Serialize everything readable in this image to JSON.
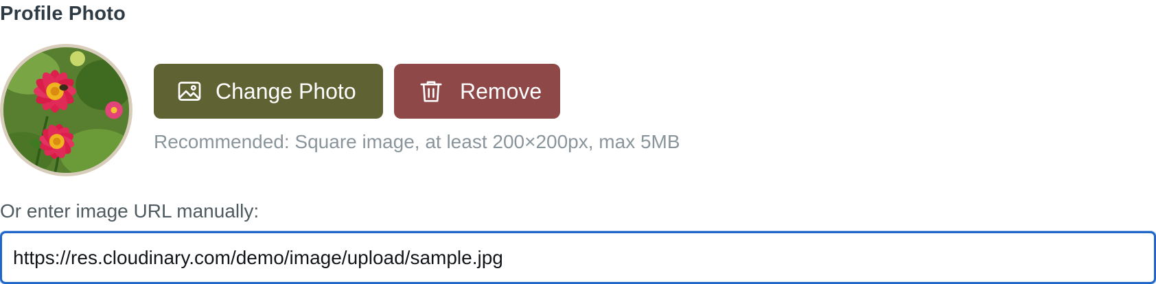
{
  "profile_photo": {
    "title": "Profile Photo",
    "avatar_icon": "flower-photo-avatar",
    "change_button": {
      "label": "Change Photo",
      "icon": "image-icon"
    },
    "remove_button": {
      "label": "Remove",
      "icon": "trash-icon"
    },
    "hint": "Recommended: Square image, at least 200×200px, max 5MB"
  },
  "url_field": {
    "label": "Or enter image URL manually:",
    "value": "https://res.cloudinary.com/demo/image/upload/sample.jpg"
  },
  "colors": {
    "change_button_bg": "#5f6233",
    "remove_button_bg": "#8e4848",
    "input_focus_border": "#1f66c8",
    "avatar_ring": "#d8cdbb"
  }
}
